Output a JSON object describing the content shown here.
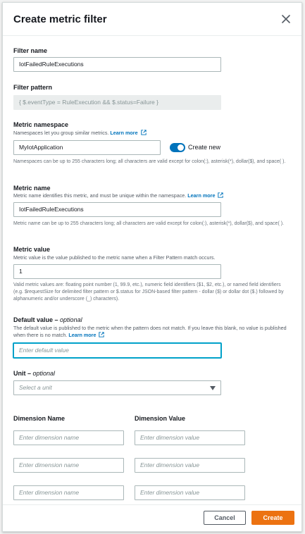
{
  "dialog": {
    "title": "Create metric filter"
  },
  "filter_name": {
    "label": "Filter name",
    "value": "IotFailedRuleExecutions"
  },
  "filter_pattern": {
    "label": "Filter pattern",
    "value": "{ $.eventType = RuleExecution && $.status=Failure }"
  },
  "metric_namespace": {
    "label": "Metric namespace",
    "description": "Namespaces let you group similar metrics.",
    "learn_more": "Learn more",
    "value": "MyIotApplication",
    "toggle_label": "Create new",
    "toggle_on": true,
    "hint": "Namespaces can be up to 255 characters long; all characters are valid except for colon(:), asterisk(*), dollar($), and space( )."
  },
  "metric_name": {
    "label": "Metric name",
    "description": "Metric name identifies this metric, and must be unique within the namespace.",
    "learn_more": "Learn more",
    "value": "IotFailedRuleExecutions",
    "hint": "Metric name can be up to 255 characters long; all characters are valid except for colon(:), asterisk(*), dollar($), and space( )."
  },
  "metric_value": {
    "label": "Metric value",
    "description": "Metric value is the value published to the metric name when a Filter Pattern match occurs.",
    "value": "1",
    "hint": "Valid metric values are: floating point number (1, 99.9, etc.), numeric field identifiers ($1, $2, etc.), or named field identifiers (e.g. $requestSize for delimited filter pattern or $.status for JSON-based filter pattern - dollar ($) or dollar dot ($.) followed by alphanumeric and/or underscore (_) characters)."
  },
  "default_value": {
    "label": "Default value",
    "optional": "optional",
    "description": "The default value is published to the metric when the pattern does not match. If you leave this blank, no value is published when there is no match.",
    "learn_more": "Learn more",
    "placeholder": "Enter default value"
  },
  "unit": {
    "label": "Unit",
    "optional": "optional",
    "placeholder": "Select a unit"
  },
  "dimensions": {
    "name_header": "Dimension Name",
    "value_header": "Dimension Value",
    "name_placeholder": "Enter dimension name",
    "value_placeholder": "Enter dimension value",
    "rows": 3
  },
  "footer": {
    "cancel_label": "Cancel",
    "create_label": "Create"
  },
  "colors": {
    "primary": "#ec7211",
    "link": "#0073bb",
    "focus": "#00a1c9"
  },
  "icons": [
    "close-icon",
    "external-link-icon",
    "caret-down-icon"
  ]
}
